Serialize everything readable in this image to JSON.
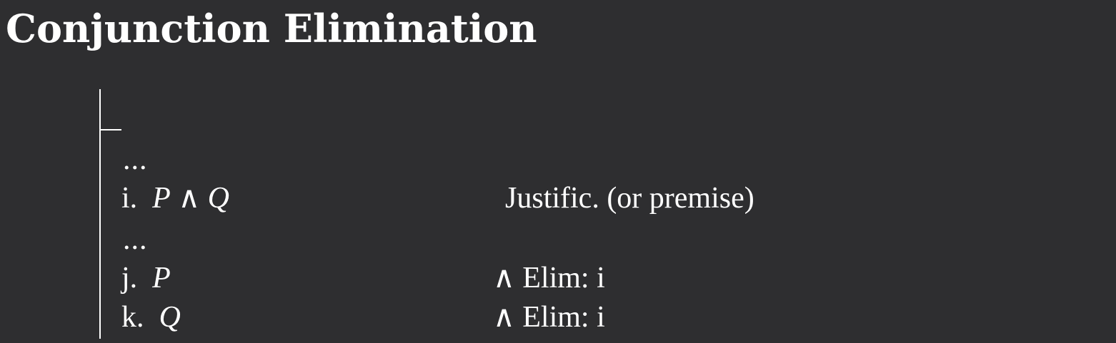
{
  "title": "Conjunction Elimination",
  "proof": {
    "dots_1": "...",
    "line_i": {
      "number": "i.",
      "formula_p": "P",
      "connective": "∧",
      "formula_q": "Q",
      "justification": "Justific. (or premise)"
    },
    "dots_2": "...",
    "line_j": {
      "number": "j.",
      "formula": "P",
      "justification": "∧ Elim: i"
    },
    "line_k": {
      "number": "k.",
      "formula": "Q",
      "justification": "∧ Elim: i"
    }
  }
}
